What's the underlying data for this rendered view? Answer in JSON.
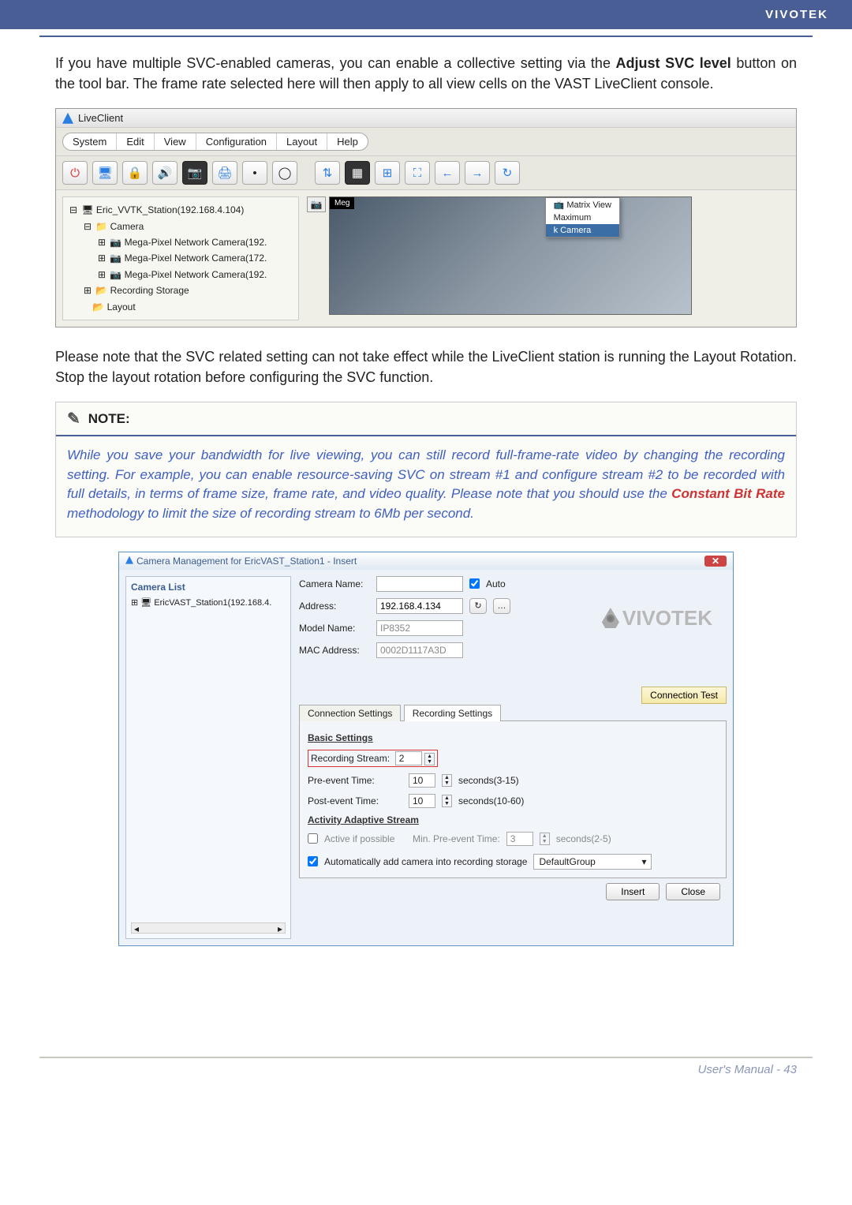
{
  "header": {
    "brand": "VIVOTEK"
  },
  "para1_prefix": "If you have multiple SVC-enabled cameras, you can enable a collective setting via the ",
  "para1_bold": "Adjust SVC level",
  "para1_suffix": " button on the tool bar. The frame rate selected here will then apply to all view cells on the VAST LiveClient console.",
  "liveclient": {
    "title": "LiveClient",
    "menu": [
      "System",
      "Edit",
      "View",
      "Configuration",
      "Layout",
      "Help"
    ],
    "tree": {
      "root": "Eric_VVTK_Station(192.168.4.104)",
      "camera_folder": "Camera",
      "cams": [
        "Mega-Pixel Network Camera(192.",
        "Mega-Pixel Network Camera(172.",
        "Mega-Pixel Network Camera(192."
      ],
      "storage": "Recording Storage",
      "layout": "Layout"
    },
    "svc_popup": {
      "item1": "Matrix View",
      "item2": "Maximum",
      "sub": "k Camera"
    },
    "video_label": "Meg"
  },
  "para2": "Please note that the SVC related setting can not take effect while the LiveClient station is running the Layout Rotation. Stop the layout rotation before configuring the SVC function.",
  "note": {
    "title": "NOTE:",
    "body_prefix": "While you save your bandwidth for live viewing, you can still record full-frame-rate video by changing the recording setting. For example, you can enable resource-saving SVC on stream #1 and configure stream #2 to be recorded with full details, in terms of frame size, frame rate, and video quality. Please note that you should use the ",
    "body_red": "Constant Bit Rate",
    "body_suffix": " methodology to limit the size of recording stream to 6Mb per second."
  },
  "cm": {
    "title": "Camera Management for EricVAST_Station1 - Insert",
    "list_title": "Camera List",
    "station": "EricVAST_Station1(192.168.4.",
    "labels": {
      "camera_name": "Camera Name:",
      "address": "Address:",
      "model": "Model Name:",
      "mac": "MAC Address:",
      "auto": "Auto"
    },
    "values": {
      "address": "192.168.4.134",
      "model": "IP8352",
      "mac": "0002D1117A3D"
    },
    "logo": "VIVOTEK",
    "conn_test": "Connection Test",
    "tabs": {
      "conn": "Connection Settings",
      "rec": "Recording Settings"
    },
    "basic": {
      "title": "Basic Settings",
      "rec_stream_label": "Recording Stream:",
      "rec_stream": "2",
      "pre_label": "Pre-event Time:",
      "pre_val": "10",
      "pre_hint": "seconds(3-15)",
      "post_label": "Post-event Time:",
      "post_val": "10",
      "post_hint": "seconds(10-60)"
    },
    "aas": {
      "title": "Activity Adaptive Stream",
      "active": "Active if possible",
      "min_pre_label": "Min. Pre-event Time:",
      "min_pre_val": "3",
      "min_pre_hint": "seconds(2-5)"
    },
    "auto_add": "Automatically add camera into recording storage",
    "group": "DefaultGroup",
    "insert": "Insert",
    "close": "Close"
  },
  "footer": "User's Manual - 43"
}
